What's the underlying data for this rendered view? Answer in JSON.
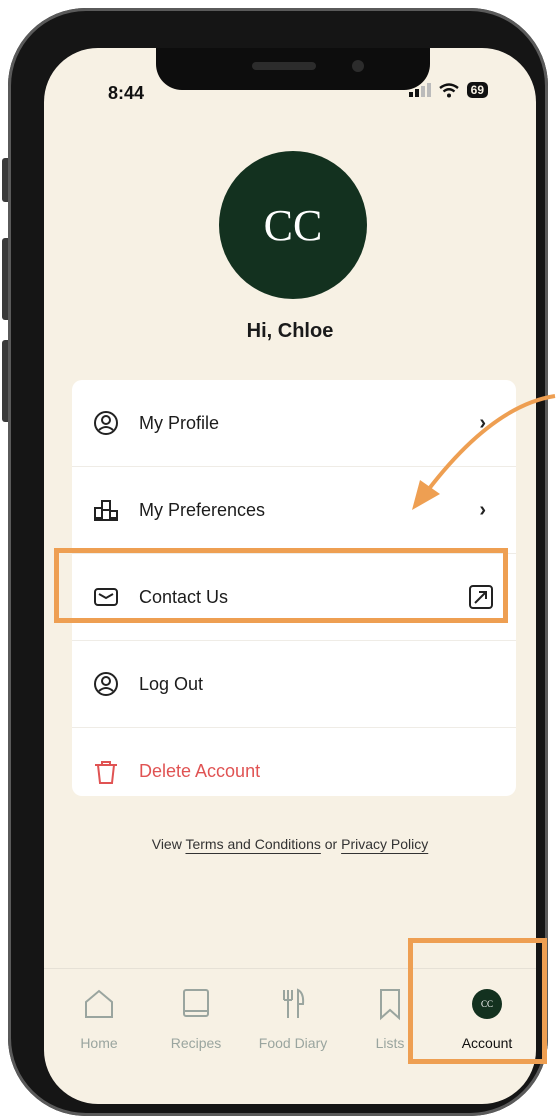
{
  "status": {
    "time": "8:44",
    "battery": "69"
  },
  "profile": {
    "initials": "CC",
    "greeting": "Hi, Chloe"
  },
  "menu": {
    "my_profile": "My Profile",
    "my_preferences": "My Preferences",
    "contact_us": "Contact Us",
    "log_out": "Log Out",
    "delete_account": "Delete Account"
  },
  "footer": {
    "prefix": "View",
    "terms": "Terms and Conditions",
    "or": "or",
    "privacy": "Privacy Policy"
  },
  "tabs": {
    "home": "Home",
    "recipes": "Recipes",
    "food_diary": "Food Diary",
    "lists": "Lists",
    "account": "Account",
    "account_initials": "CC"
  },
  "colors": {
    "background": "#f7f1e4",
    "avatar": "#13311f",
    "danger": "#e05353",
    "highlight": "#ee9f52",
    "inactive_tab": "#9aa59f"
  }
}
